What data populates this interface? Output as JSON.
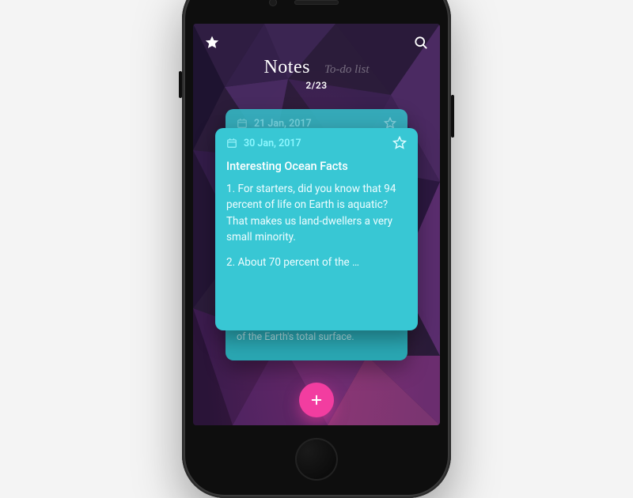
{
  "header": {
    "tabs": {
      "active": "Notes",
      "inactive": "To-do list"
    },
    "counter": "2/23"
  },
  "icons": {
    "favorites": "star-icon",
    "search": "search-icon",
    "calendar": "calendar-icon",
    "card_star": "star-outline-icon",
    "add": "plus-icon"
  },
  "colors": {
    "accent_pink": "#f23da0",
    "card_teal": "#38c7d4",
    "card_teal_back": "#35b8c4",
    "card_teal_under": "#2aa7b3"
  },
  "cards": {
    "back": {
      "date": "21 Jan, 2017"
    },
    "front": {
      "date": "30 Jan, 2017",
      "title": "Interesting Ocean Facts",
      "body1": "1. For starters, did you know that 94 percent of life on Earth is aquatic? That makes us land-dwellers a very small minority.",
      "body2": "2. About 70 percent of the …"
    },
    "under": {
      "text": "of the Earth's total surface."
    }
  }
}
